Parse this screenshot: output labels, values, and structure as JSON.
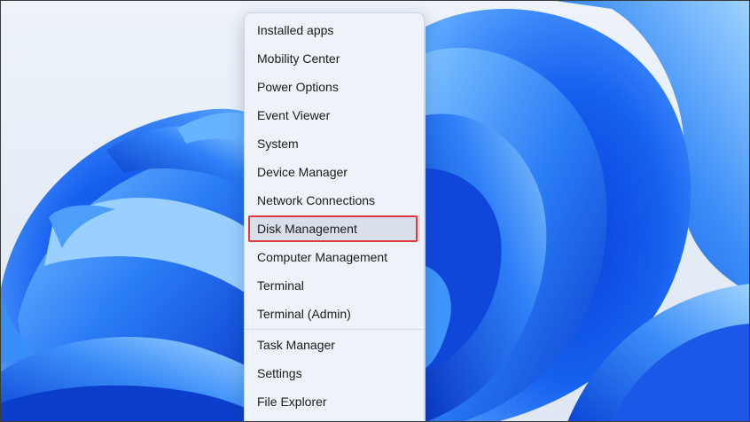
{
  "desktop": {
    "wallpaper_icon": "windows-11-bloom-wallpaper",
    "accent_color": "#1a5cf0"
  },
  "quick_link_menu": {
    "group_1": [
      {
        "label": "Installed apps"
      },
      {
        "label": "Mobility Center"
      },
      {
        "label": "Power Options"
      },
      {
        "label": "Event Viewer"
      },
      {
        "label": "System"
      },
      {
        "label": "Device Manager"
      },
      {
        "label": "Network Connections"
      },
      {
        "label": "Disk Management",
        "highlighted": true
      },
      {
        "label": "Computer Management"
      },
      {
        "label": "Terminal"
      },
      {
        "label": "Terminal (Admin)"
      }
    ],
    "group_2": [
      {
        "label": "Task Manager"
      },
      {
        "label": "Settings"
      },
      {
        "label": "File Explorer"
      }
    ],
    "highlight_color": "#e0393e"
  }
}
